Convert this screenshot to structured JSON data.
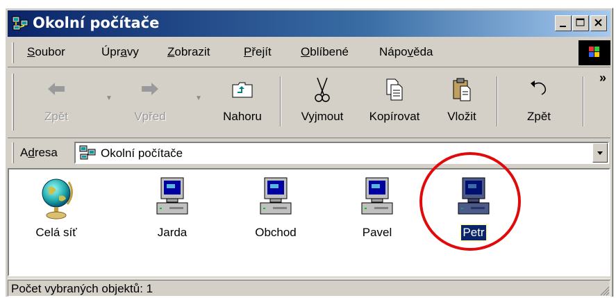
{
  "window": {
    "title": "Okolní počítače"
  },
  "menu": {
    "items": [
      {
        "pre": "",
        "u": "S",
        "post": "oubor"
      },
      {
        "pre": "Úpr",
        "u": "a",
        "post": "vy"
      },
      {
        "pre": "",
        "u": "Z",
        "post": "obrazit"
      },
      {
        "pre": "",
        "u": "P",
        "post": "řejít"
      },
      {
        "pre": "",
        "u": "O",
        "post": "blíbené"
      },
      {
        "pre": "Nápo",
        "u": "v",
        "post": "ěda"
      }
    ]
  },
  "toolbar": {
    "back_label": "Zpět",
    "forward_label": "Vpřed",
    "up_label": "Nahoru",
    "cut_label": "Vyjmout",
    "copy_label": "Kopírovat",
    "paste_label": "Vložit",
    "undo_label": "Zpět",
    "more": "»"
  },
  "address": {
    "label_pre": "A",
    "label_u": "d",
    "label_post": "resa",
    "value": "Okolní počítače"
  },
  "items": [
    {
      "label": "Celá síť",
      "icon": "globe-icon"
    },
    {
      "label": "Jarda",
      "icon": "computer-icon"
    },
    {
      "label": "Obchod",
      "icon": "computer-icon"
    },
    {
      "label": "Pavel",
      "icon": "computer-icon"
    },
    {
      "label": "Petr",
      "icon": "computer-icon",
      "selected": true
    }
  ],
  "status": {
    "text": "Počet vybraných objektů: 1"
  },
  "colors": {
    "titlebar_start": "#0a246a",
    "titlebar_end": "#a6caf0",
    "selection": "#0a246a",
    "annotation_circle": "#e10a0a"
  }
}
